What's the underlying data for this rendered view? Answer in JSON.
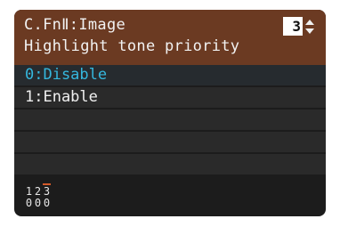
{
  "header": {
    "title": "C.FnⅡ:Image",
    "subtitle": "Highlight tone priority",
    "number": "3",
    "arrows_icon": "up-down-arrows-icon"
  },
  "options": [
    {
      "label": "0:Disable",
      "selected": true
    },
    {
      "label": "1:Enable",
      "selected": false
    },
    {
      "label": "",
      "selected": false
    },
    {
      "label": "",
      "selected": false
    },
    {
      "label": "",
      "selected": false
    }
  ],
  "footer": {
    "indices": [
      "1",
      "2",
      "3"
    ],
    "values": [
      "0",
      "0",
      "0"
    ],
    "active_index": "3"
  },
  "colors": {
    "header_bg": "#6b3a22",
    "selected_text": "#35b7de",
    "active_marker": "#d35a2a"
  }
}
